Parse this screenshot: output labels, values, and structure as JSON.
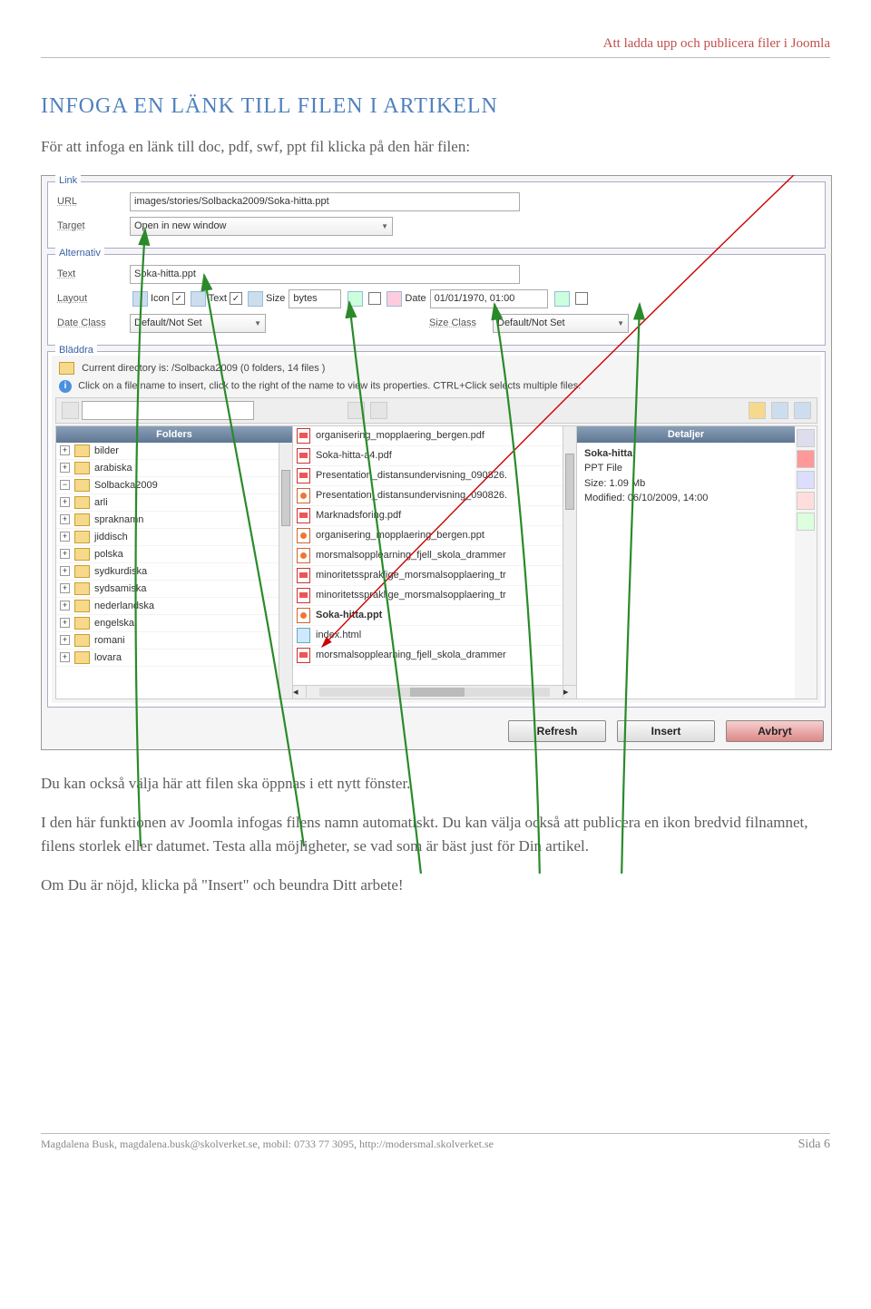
{
  "header": {
    "doc_title": "Att ladda upp och publicera filer i Joomla"
  },
  "h1": "INFOGA EN LÄNK TILL FILEN I ARTIKELN",
  "intro": "För att infoga en länk till doc, pdf, swf, ppt fil klicka på den här filen:",
  "post1": "Du kan också välja här att filen ska öppnas i ett nytt fönster.",
  "post2": "I den här funktionen av Joomla infogas filens namn automatiskt. Du kan välja också att publicera en ikon bredvid filnamnet, filens storlek eller datumet. Testa alla möjligheter, se vad som är bäst just för Din artikel.",
  "post3": "Om Du är nöjd, klicka på \"Insert\" och beundra Ditt arbete!",
  "footer": {
    "left": "Magdalena Busk, magdalena.busk@skolverket.se,  mobil: 0733 77 3095, http://modersmal.skolverket.se",
    "right": "Sida 6"
  },
  "link_section": {
    "legend": "Link",
    "url_label": "URL",
    "url_value": "images/stories/Solbacka2009/Soka-hitta.ppt",
    "target_label": "Target",
    "target_value": "Open in new window"
  },
  "alt_section": {
    "legend": "Alternativ",
    "text_label": "Text",
    "text_value": "Soka-hitta.ppt",
    "layout_label": "Layout",
    "layout_icon": "Icon",
    "layout_text": "Text",
    "layout_size": "Size",
    "layout_size_val": "bytes",
    "layout_date": "Date",
    "layout_date_val": "01/01/1970, 01:00",
    "dateclass_label": "Date Class",
    "dateclass_val": "Default/Not Set",
    "sizeclass_label": "Size Class",
    "sizeclass_val": "Default/Not Set"
  },
  "browse_section": {
    "legend": "Bläddra",
    "current_dir": "Current directory is: /Solbacka2009 (0 folders, 14 files )",
    "hint": "Click on a file name to insert, click to the right of the name to view its properties. CTRL+Click selects multiple files."
  },
  "panes": {
    "folders_head": "Folders",
    "details_head": "Detaljer",
    "folders": [
      "bilder",
      "arabiska",
      "Solbacka2009",
      "arli",
      "spraknamn",
      "jiddisch",
      "polska",
      "sydkurdiska",
      "sydsamiska",
      "nederlandska",
      "engelska",
      "romani",
      "lovara"
    ],
    "files": [
      {
        "name": "organisering_mopplaering_bergen.pdf",
        "type": "pdf"
      },
      {
        "name": "Soka-hitta-a4.pdf",
        "type": "pdf"
      },
      {
        "name": "Presentation_distansundervisning_090826.",
        "type": "pdf"
      },
      {
        "name": "Presentation_distansundervisning_090826.",
        "type": "ppt"
      },
      {
        "name": "Marknadsforing.pdf",
        "type": "pdf"
      },
      {
        "name": "organisering_mopplaering_bergen.ppt",
        "type": "ppt"
      },
      {
        "name": "morsmalsopplearning_fjell_skola_drammer",
        "type": "ppt"
      },
      {
        "name": "minoritetsspraklige_morsmalsopplaering_tr",
        "type": "pdf"
      },
      {
        "name": "minoritetsspraklige_morsmalsopplaering_tr",
        "type": "pdf"
      },
      {
        "name": "Soka-hitta.ppt",
        "type": "ppt",
        "bold": true
      },
      {
        "name": "index.html",
        "type": "html"
      },
      {
        "name": "morsmalsopplearning_fjell_skola_drammer",
        "type": "pdf"
      }
    ],
    "details": {
      "name": "Soka-hitta",
      "type": "PPT File",
      "size": "Size: 1.09 Mb",
      "modified": "Modified: 06/10/2009, 14:00"
    }
  },
  "buttons": {
    "refresh": "Refresh",
    "insert": "Insert",
    "cancel": "Avbryt"
  }
}
